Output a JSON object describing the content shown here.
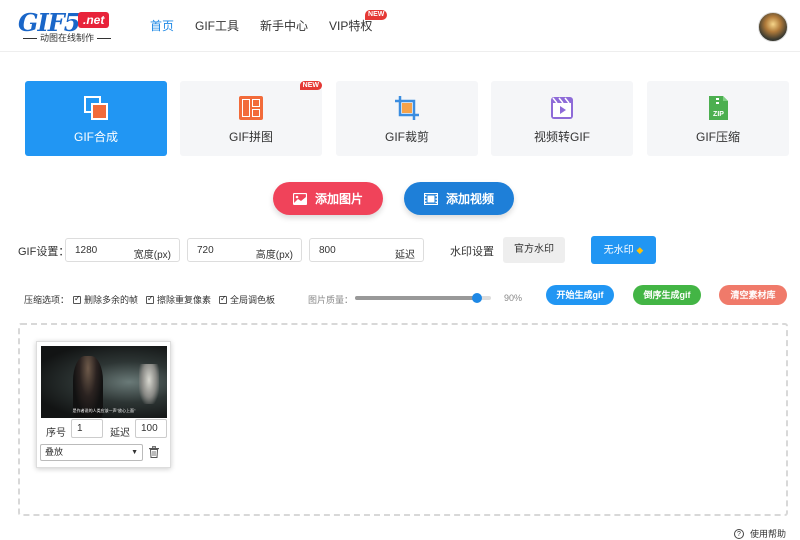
{
  "header": {
    "logo": {
      "main": "GIF5",
      "net": ".net",
      "subtitle": "动图在线制作"
    },
    "nav": [
      {
        "label": "首页"
      },
      {
        "label": "GIF工具"
      },
      {
        "label": "新手中心"
      },
      {
        "label": "VIP特权",
        "badge": "NEW"
      }
    ]
  },
  "tools": [
    {
      "label": "GIF合成",
      "icon": "merge-icon"
    },
    {
      "label": "GIF拼图",
      "icon": "collage-icon",
      "badge": "NEW"
    },
    {
      "label": "GIF裁剪",
      "icon": "crop-icon"
    },
    {
      "label": "视频转GIF",
      "icon": "video-icon"
    },
    {
      "label": "GIF压缩",
      "icon": "zip-icon",
      "icon_text": "ZIP"
    }
  ],
  "actions": {
    "add_image": "添加图片",
    "add_video": "添加视频"
  },
  "gif_settings": {
    "label": "GIF设置：",
    "width": {
      "value": "1280",
      "unit": "宽度(px)"
    },
    "height": {
      "value": "720",
      "unit": "高度(px)"
    },
    "delay": {
      "value": "800",
      "unit": "延迟"
    },
    "watermark_label": "水印设置",
    "watermark_official": "官方水印",
    "watermark_none": "无水印"
  },
  "compression": {
    "label": "压缩选项：",
    "options": [
      "删除多余的帧",
      "擦除重复像素",
      "全局调色板"
    ],
    "quality_label": "图片质量：",
    "quality_value": "90%",
    "quality_fraction": 0.9,
    "generate": "开始生成gif",
    "reverse": "倒序生成gif",
    "clear": "清空素材库"
  },
  "frame": {
    "subtitle": "是作者说的人类应该一声\"放心上面\"",
    "seq_label": "序号",
    "seq_value": "1",
    "delay_label": "延迟",
    "delay_value": "100",
    "mode": "叠放"
  },
  "help": "使用帮助",
  "colors": {
    "accent": "#2196f3",
    "red": "#f0435a",
    "green": "#43b545",
    "salmon": "#f07a6a"
  }
}
